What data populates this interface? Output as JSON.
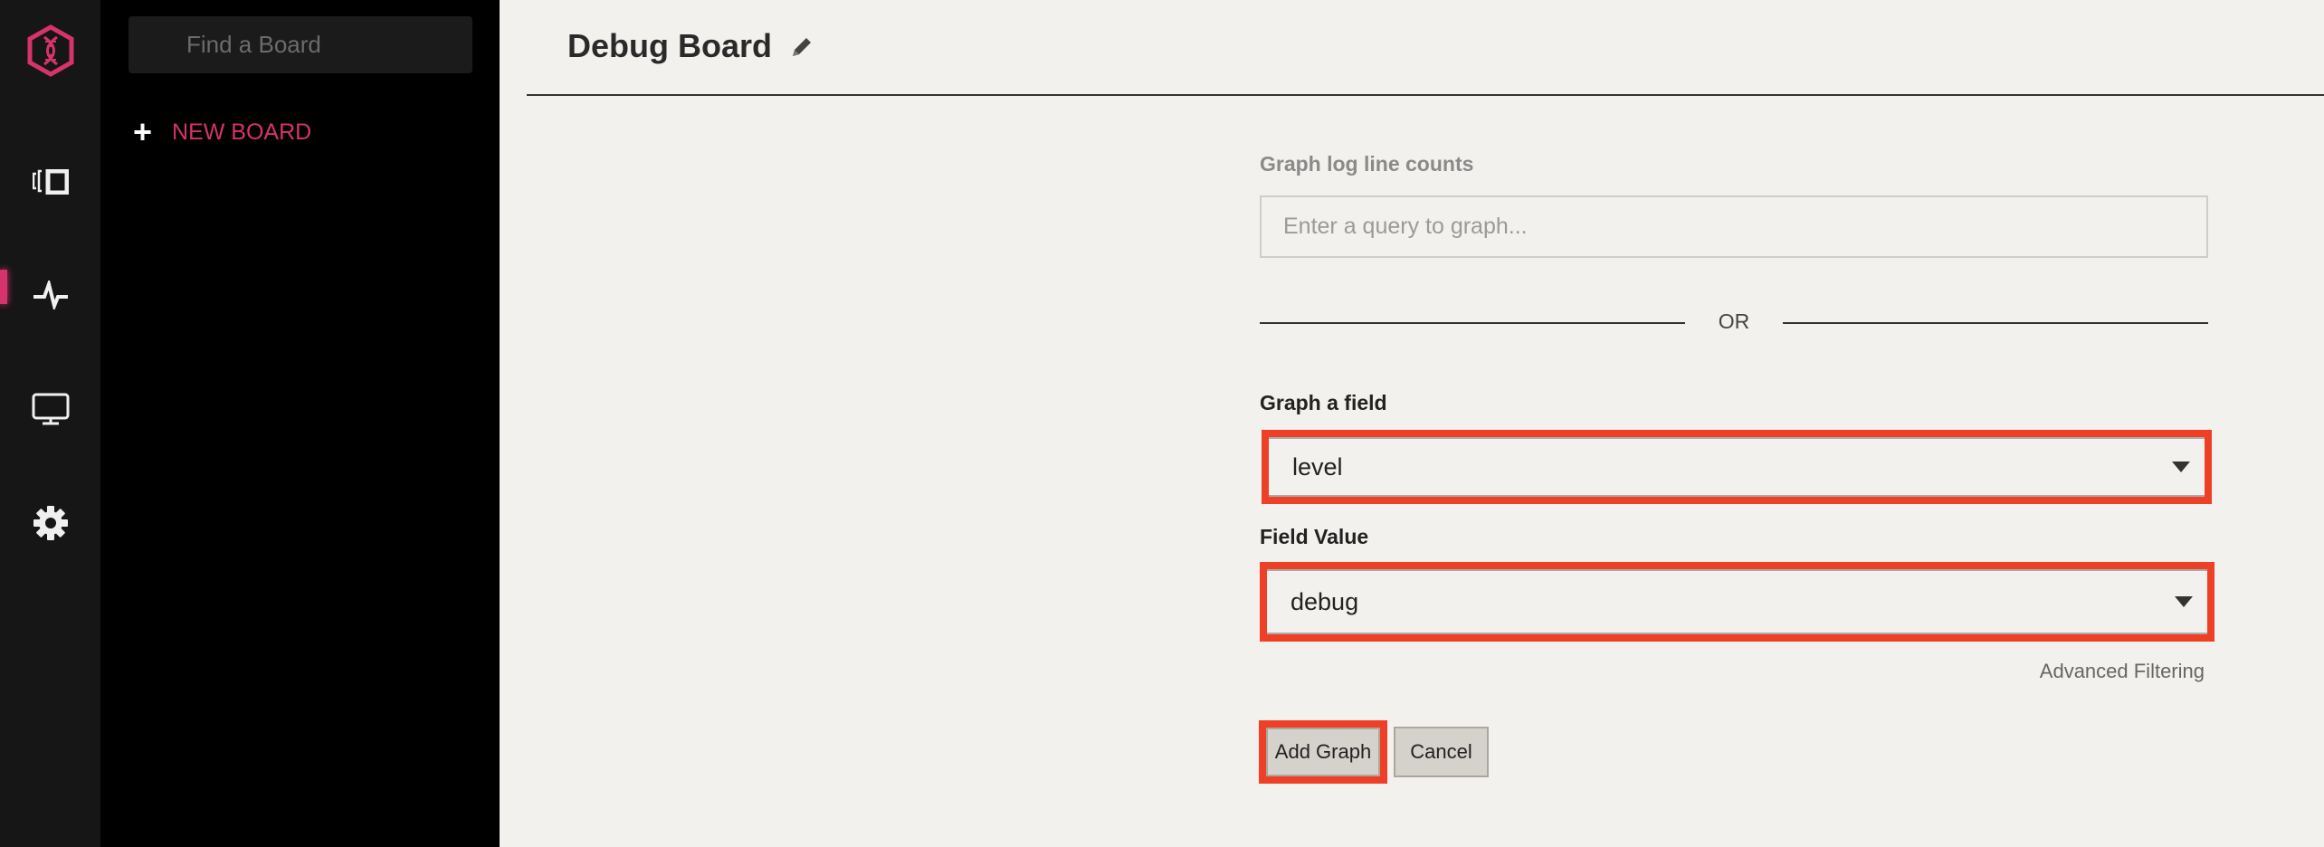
{
  "colors": {
    "accent": "#d6336c",
    "highlight": "#ee4027",
    "rail_bg": "#161616",
    "panel_bg": "#000000",
    "content_bg": "#f2f1ed"
  },
  "rail": {
    "icons": [
      "logo-icon",
      "boards-icon",
      "pulse-icon",
      "monitor-icon",
      "gear-icon"
    ],
    "active": "pulse-icon"
  },
  "panel": {
    "search_placeholder": "Find a Board",
    "new_board_label": "NEW BOARD"
  },
  "header": {
    "title": "Debug Board"
  },
  "form": {
    "query_label": "Graph log line counts",
    "query_placeholder": "Enter a query to graph...",
    "query_value": "",
    "or_label": "OR",
    "field_label": "Graph a field",
    "field_value": "level",
    "value_label": "Field Value",
    "value_value": "debug",
    "advanced_label": "Advanced Filtering",
    "add_label": "Add Graph",
    "cancel_label": "Cancel"
  }
}
